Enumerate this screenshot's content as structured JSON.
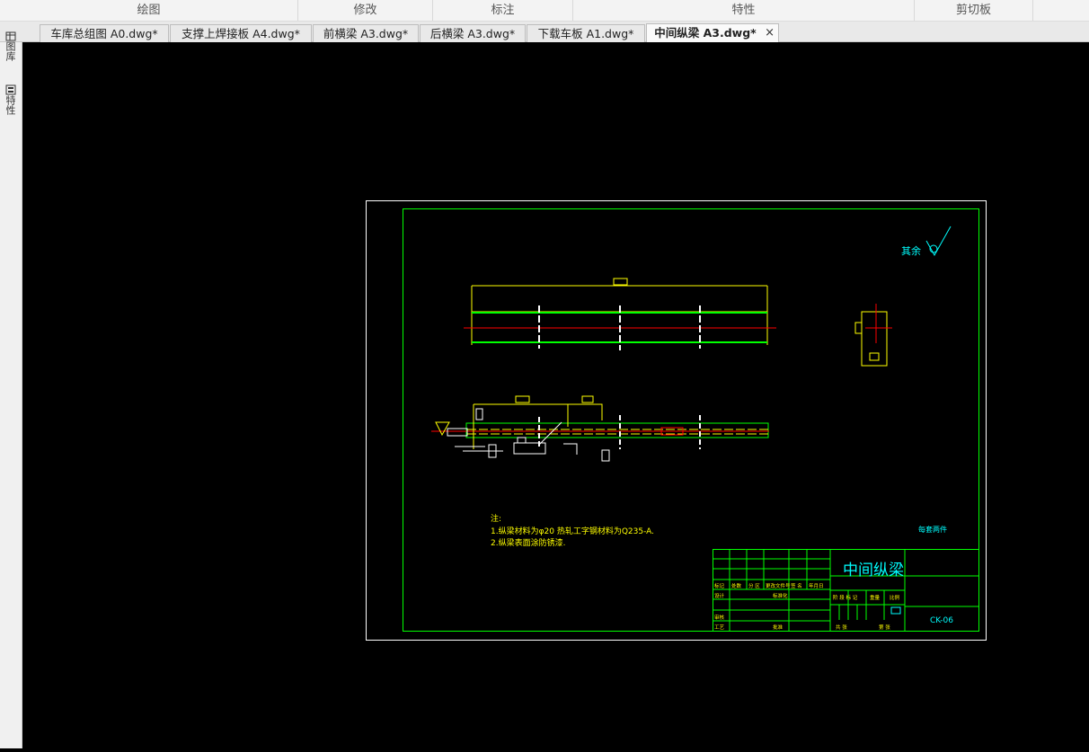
{
  "ribbon": {
    "groups": [
      "绘图",
      "修改",
      "标注",
      "特性",
      "剪切板"
    ]
  },
  "tabs": [
    {
      "label": "车库总组图 A0.dwg*"
    },
    {
      "label": "支撑上焊接板 A4.dwg*"
    },
    {
      "label": "前横梁 A3.dwg*"
    },
    {
      "label": "后横梁 A3.dwg*"
    },
    {
      "label": "下载车板 A1.dwg*"
    },
    {
      "label": "中间纵梁 A3.dwg*",
      "active": true
    }
  ],
  "tab_close_glyph": "×",
  "side_panel": {
    "items": [
      {
        "label": "图库",
        "icon": "library-icon"
      },
      {
        "label": "特性",
        "icon": "properties-icon"
      }
    ]
  },
  "drawing": {
    "roughness_note": "其余",
    "notes_title": "注:",
    "notes": [
      "1.纵梁材料为φ20 热轧工字钢材料为Q235-A.",
      "2.纵梁表面涂防锈漆."
    ],
    "company_mark": "每套两件",
    "title": "中间纵梁",
    "drawing_number": "CK-06",
    "titleblock_labels": {
      "mark": "标记",
      "count": "处数",
      "zone": "分 区",
      "change_doc": "更改文件号",
      "sign": "签 名",
      "date": "年月日",
      "design": "设计",
      "standardize": "标准化",
      "check": "审核",
      "process": "工艺",
      "approve": "批准",
      "stage_mark": "阶 段 标 记",
      "weight": "重量",
      "scale": "比例",
      "total": "共 张",
      "sheet": "第 张"
    }
  },
  "colors": {
    "canvas_bg": "#000000",
    "frame": "#ffffff",
    "border": "#00ff00",
    "centerline": "#ff0000",
    "dimension": "#ffff00",
    "title_text": "#00ffff"
  }
}
